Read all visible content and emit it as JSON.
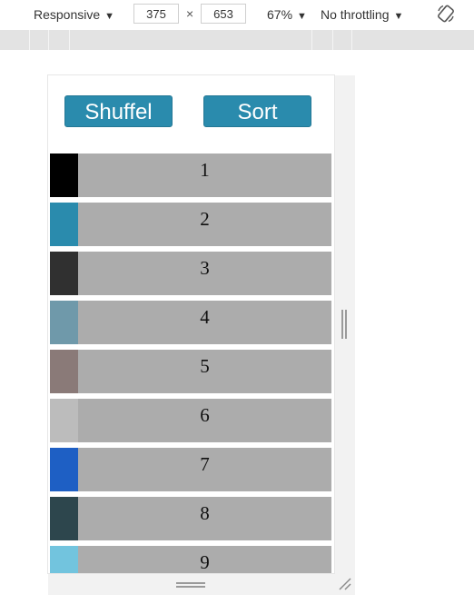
{
  "toolbar": {
    "device_mode": "Responsive",
    "width_value": "375",
    "times": "×",
    "height_value": "653",
    "zoom": "67%",
    "throttling": "No throttling",
    "caret": "▼",
    "rotate_icon": "rotate-icon"
  },
  "page": {
    "shuffle_label": "Shuffel",
    "sort_label": "Sort",
    "items": [
      {
        "label": "1",
        "color": "#000000"
      },
      {
        "label": "2",
        "color": "#2a8bad"
      },
      {
        "label": "3",
        "color": "#303030"
      },
      {
        "label": "4",
        "color": "#6f99aa"
      },
      {
        "label": "5",
        "color": "#8a7a78"
      },
      {
        "label": "6",
        "color": "#bcbcbc"
      },
      {
        "label": "7",
        "color": "#1e5fc4"
      },
      {
        "label": "8",
        "color": "#2d464d"
      },
      {
        "label": "9",
        "color": "#72c4de"
      }
    ]
  },
  "colors": {
    "button_bg": "#2a8bad",
    "row_bg": "#acacac"
  }
}
